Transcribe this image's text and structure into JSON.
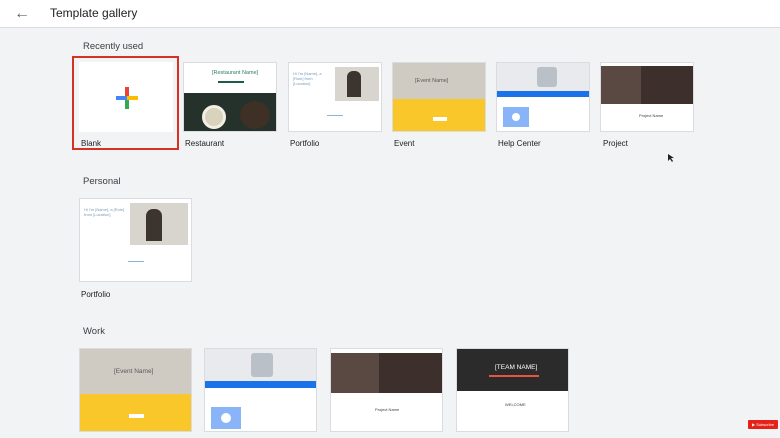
{
  "header": {
    "title": "Template gallery",
    "back_icon": "back-arrow-icon"
  },
  "sections": {
    "recently_used": "Recently used",
    "personal": "Personal",
    "work": "Work"
  },
  "recent": {
    "blank": "Blank",
    "restaurant": "Restaurant",
    "portfolio": "Portfolio",
    "event": "Event",
    "help_center": "Help Center",
    "project": "Project"
  },
  "personal": {
    "portfolio": "Portfolio"
  },
  "thumb_text": {
    "restaurant_title": "[Restaurant Name]",
    "portfolio_heading": "Hi I'm [Name], a [Role] from [Location]",
    "event_title": "[Event Name]",
    "team_name": "[TEAM NAME]",
    "welcome": "WELCOME",
    "project_name": "Project Name"
  },
  "colors": {
    "accent": "#d93025",
    "event_yellow": "#f9c72a",
    "help_blue": "#1a73e8"
  }
}
